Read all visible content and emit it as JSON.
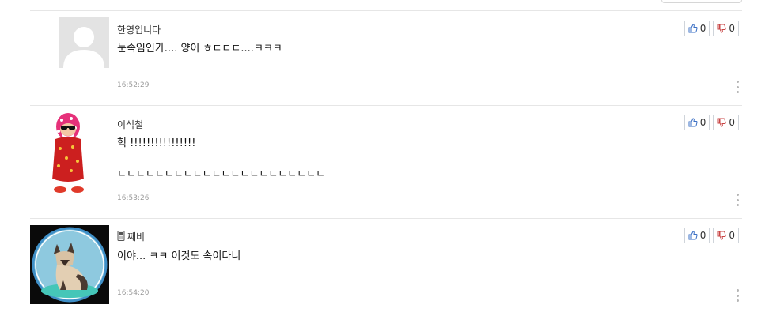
{
  "comments": [
    {
      "author": "한영입니다",
      "author_icon": "",
      "avatar": "default-user-icon",
      "text": "눈속임인가.... 양이 ㅎㄷㄷㄷ....ㅋㅋㅋ",
      "time": "16:52:29",
      "likes": "0",
      "dislikes": "0"
    },
    {
      "author": "이석철",
      "author_icon": "",
      "avatar": "pixel-character-avatar",
      "text": "헉 !!!!!!!!!!!!!!!!\n\nㄷㄷㄷㄷㄷㄷㄷㄷㄷㄷㄷㄷㄷㄷㄷㄷㄷㄷㄷㄷㄷㄷ",
      "time": "16:53:26",
      "likes": "0",
      "dislikes": "0"
    },
    {
      "author": "째비",
      "author_icon": "mobile-phone-icon",
      "avatar": "cat-photo-avatar",
      "text": "이야... ㅋㅋ 이것도 속이다니",
      "time": "16:54:20",
      "likes": "0",
      "dislikes": "0"
    }
  ],
  "colors": {
    "divider": "#e6e6e6",
    "timestamp": "#9a9a9a",
    "like_icon": "#3a6fc4",
    "dislike_icon": "#c84444"
  }
}
